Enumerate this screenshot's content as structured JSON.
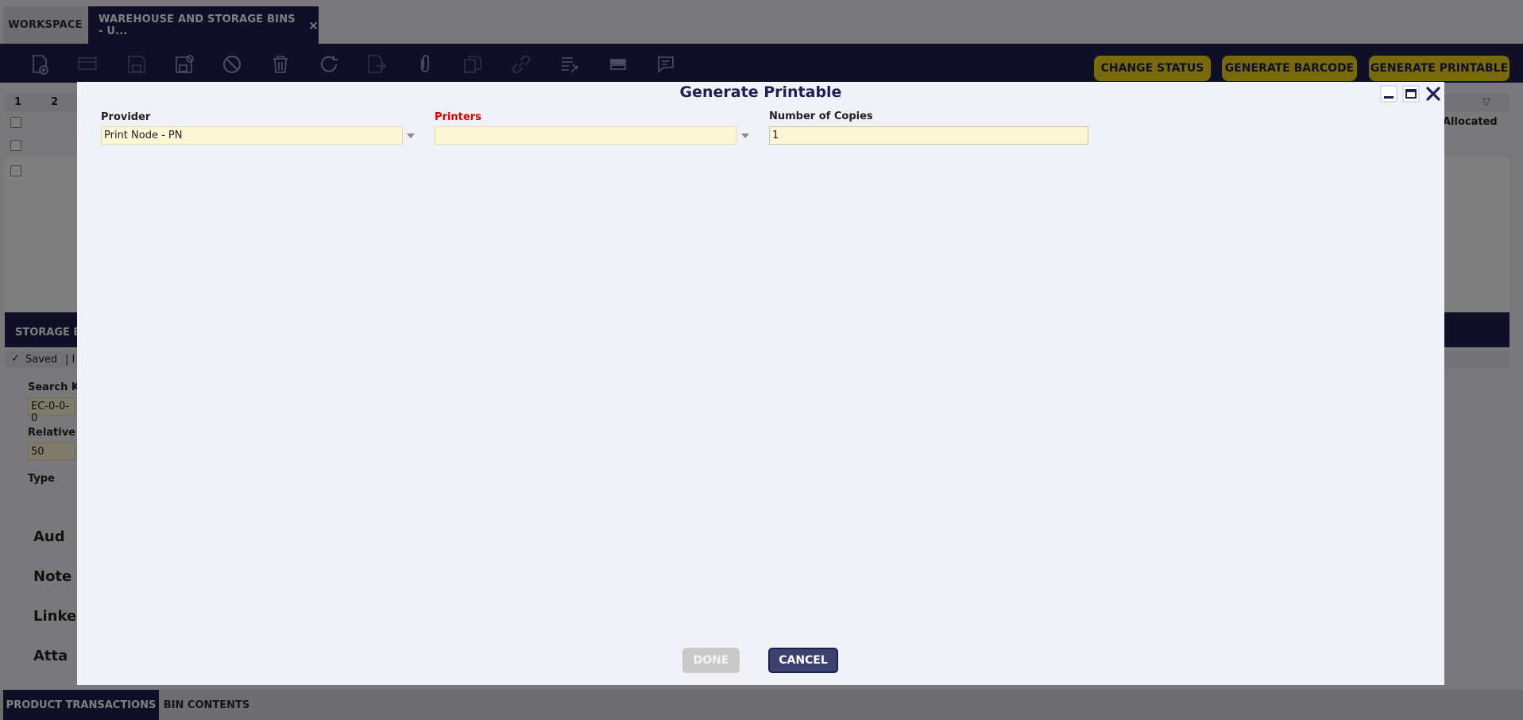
{
  "tabs": {
    "workspace": "WORKSPACE",
    "active": "WAREHOUSE AND STORAGE BINS - U...",
    "close_glyph": "×"
  },
  "toolbar": {
    "icons": [
      "new-document-icon",
      "new-row-icon",
      "save-icon",
      "save-close-icon",
      "cancel-icon",
      "delete-icon",
      "refresh-icon",
      "export-icon",
      "attachment-icon",
      "copy-icon",
      "link-icon",
      "audit-icon",
      "grid-view-icon",
      "notes-icon"
    ],
    "actions": {
      "change_status": "CHANGE STATUS",
      "generate_barcode": "GENERATE BARCODE",
      "generate_printable": "GENERATE PRINTABLE"
    }
  },
  "grid": {
    "col1": "1",
    "col2": "2",
    "allocated": "Allocated"
  },
  "detail": {
    "tab": "STORAGE BI",
    "status": "Saved",
    "status_sep": "| I",
    "search_key_label": "Search Ke",
    "search_key_value": "EC-0-0-0",
    "relative_label": "Relative Pr",
    "relative_value": "50",
    "type_label": "Type",
    "sections": [
      "Aud",
      "Note",
      "Linke",
      "Atta"
    ]
  },
  "bottom_tabs": {
    "product_transactions": "PRODUCT TRANSACTIONS",
    "bin_contents": "BIN CONTENTS"
  },
  "dialog": {
    "title": "Generate Printable",
    "provider_label": "Provider",
    "provider_value": "Print Node - PN",
    "printers_label": "Printers",
    "printers_value": "",
    "copies_label": "Number of Copies",
    "copies_value": "1",
    "done_label": "DONE",
    "cancel_label": "CANCEL"
  },
  "colors": {
    "brand": "#1e2150",
    "accent": "#f2d21a",
    "required": "#d10000",
    "input_bg": "#fdf7d7"
  }
}
